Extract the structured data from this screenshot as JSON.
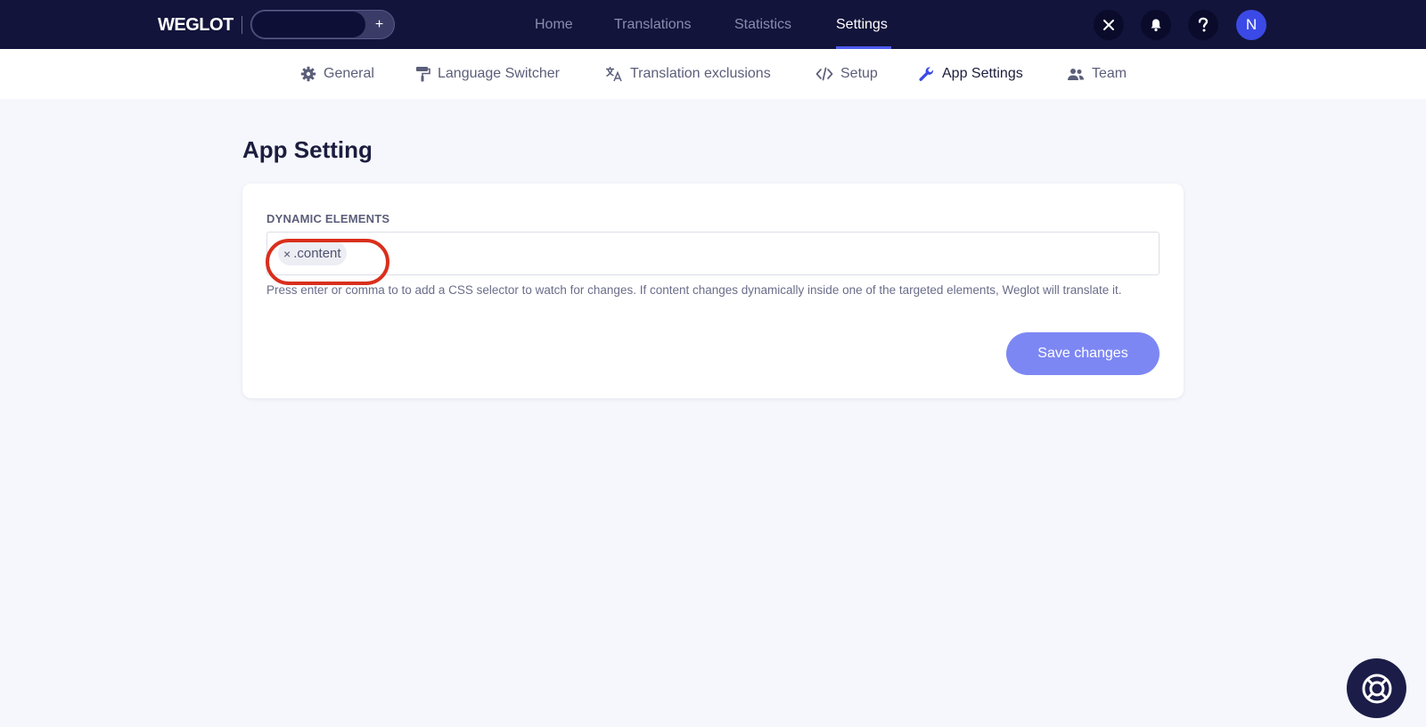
{
  "header": {
    "logo": "WEGLOT",
    "project_add": "+",
    "nav": {
      "home": "Home",
      "translations": "Translations",
      "statistics": "Statistics",
      "settings": "Settings"
    },
    "avatar_initial": "N",
    "icons": [
      "close-icon",
      "bell-icon",
      "question-icon"
    ]
  },
  "subnav": {
    "general": "General",
    "language_switcher": "Language Switcher",
    "translation_exclusions": "Translation exclusions",
    "setup": "Setup",
    "app_settings": "App Settings",
    "team": "Team"
  },
  "main": {
    "title": "App Setting",
    "dynamic_elements": {
      "label": "DYNAMIC ELEMENTS",
      "tags": [
        ".content"
      ],
      "tag_remove": "×",
      "helper": "Press enter or comma to to add a CSS selector to watch for changes. If content changes dynamically inside one of the targeted elements, Weglot will translate it."
    },
    "save_button": "Save changes"
  },
  "colors": {
    "topbar": "#13143b",
    "accent": "#4e5cf0",
    "save_button": "#7d87f3",
    "highlight": "#d92f1c"
  }
}
